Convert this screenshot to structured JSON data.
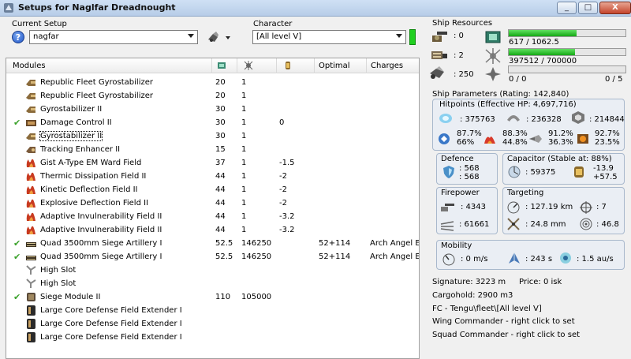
{
  "window": {
    "title": "Setups for Naglfar Dreadnought",
    "buttons": {
      "minimize": "_",
      "maximize": "□",
      "close": "X"
    }
  },
  "setup": {
    "current_setup_label": "Current Setup",
    "current_setup_value": "nagfar",
    "character_label": "Character",
    "character_value": "[All level V]"
  },
  "modules": {
    "headers": {
      "modules": "Modules",
      "optimal": "Optimal",
      "charges": "Charges"
    },
    "header_icons": [
      "cpu-icon",
      "powergrid-icon",
      "capacitor-icon"
    ],
    "rows": [
      {
        "checked": false,
        "icon": "gyrostabilizer-icon",
        "name": "Republic Fleet Gyrostabilizer",
        "cpu": "20",
        "pg": "1",
        "cap": "",
        "optimal": "",
        "charges": "",
        "selected": false
      },
      {
        "checked": false,
        "icon": "gyrostabilizer-icon",
        "name": "Republic Fleet Gyrostabilizer",
        "cpu": "20",
        "pg": "1",
        "cap": "",
        "optimal": "",
        "charges": "",
        "selected": false
      },
      {
        "checked": false,
        "icon": "gyrostabilizer-icon",
        "name": "Gyrostabilizer II",
        "cpu": "30",
        "pg": "1",
        "cap": "",
        "optimal": "",
        "charges": "",
        "selected": false
      },
      {
        "checked": true,
        "icon": "damage-control-icon",
        "name": "Damage Control II",
        "cpu": "30",
        "pg": "1",
        "cap": "0",
        "optimal": "",
        "charges": "",
        "selected": false
      },
      {
        "checked": false,
        "icon": "gyrostabilizer-icon",
        "name": "Gyrostabilizer II",
        "cpu": "30",
        "pg": "1",
        "cap": "",
        "optimal": "",
        "charges": "",
        "selected": true
      },
      {
        "checked": false,
        "icon": "tracking-enhancer-icon",
        "name": "Tracking Enhancer II",
        "cpu": "15",
        "pg": "1",
        "cap": "",
        "optimal": "",
        "charges": "",
        "selected": false
      },
      {
        "checked": false,
        "icon": "shield-hardener-icon",
        "name": "Gist A-Type EM Ward Field",
        "cpu": "37",
        "pg": "1",
        "cap": "-1.5",
        "optimal": "",
        "charges": "",
        "selected": false
      },
      {
        "checked": false,
        "icon": "shield-hardener-icon",
        "name": "Thermic Dissipation Field II",
        "cpu": "44",
        "pg": "1",
        "cap": "-2",
        "optimal": "",
        "charges": "",
        "selected": false
      },
      {
        "checked": false,
        "icon": "shield-hardener-icon",
        "name": "Kinetic Deflection Field II",
        "cpu": "44",
        "pg": "1",
        "cap": "-2",
        "optimal": "",
        "charges": "",
        "selected": false
      },
      {
        "checked": false,
        "icon": "shield-hardener-icon",
        "name": "Explosive Deflection Field II",
        "cpu": "44",
        "pg": "1",
        "cap": "-2",
        "optimal": "",
        "charges": "",
        "selected": false
      },
      {
        "checked": false,
        "icon": "shield-hardener-icon",
        "name": "Adaptive Invulnerability Field II",
        "cpu": "44",
        "pg": "1",
        "cap": "-3.2",
        "optimal": "",
        "charges": "",
        "selected": false
      },
      {
        "checked": false,
        "icon": "shield-hardener-icon",
        "name": "Adaptive Invulnerability Field II",
        "cpu": "44",
        "pg": "1",
        "cap": "-3.2",
        "optimal": "",
        "charges": "",
        "selected": false
      },
      {
        "checked": true,
        "icon": "artillery-icon",
        "name": "Quad 3500mm Siege Artillery I",
        "cpu": "52.5",
        "pg": "146250",
        "cap": "",
        "optimal": "52+114",
        "charges": "Arch Angel E",
        "selected": false
      },
      {
        "checked": true,
        "icon": "artillery-icon",
        "name": "Quad 3500mm Siege Artillery I",
        "cpu": "52.5",
        "pg": "146250",
        "cap": "",
        "optimal": "52+114",
        "charges": "Arch Angel E",
        "selected": false
      },
      {
        "checked": false,
        "icon": "high-slot-icon",
        "name": "High Slot",
        "cpu": "",
        "pg": "",
        "cap": "",
        "optimal": "",
        "charges": "",
        "selected": false
      },
      {
        "checked": false,
        "icon": "high-slot-icon",
        "name": "High Slot",
        "cpu": "",
        "pg": "",
        "cap": "",
        "optimal": "",
        "charges": "",
        "selected": false
      },
      {
        "checked": true,
        "icon": "siege-module-icon",
        "name": "Siege Module II",
        "cpu": "110",
        "pg": "105000",
        "cap": "",
        "optimal": "",
        "charges": "",
        "selected": false
      },
      {
        "checked": false,
        "icon": "rig-icon",
        "name": "Large Core Defense Field Extender I",
        "cpu": "",
        "pg": "",
        "cap": "",
        "optimal": "",
        "charges": "",
        "selected": false
      },
      {
        "checked": false,
        "icon": "rig-icon",
        "name": "Large Core Defense Field Extender I",
        "cpu": "",
        "pg": "",
        "cap": "",
        "optimal": "",
        "charges": "",
        "selected": false
      },
      {
        "checked": false,
        "icon": "rig-icon",
        "name": "Large Core Defense Field Extender I",
        "cpu": "",
        "pg": "",
        "cap": "",
        "optimal": "",
        "charges": "",
        "selected": false
      }
    ]
  },
  "resources": {
    "title": "Ship Resources",
    "turret": ": 0",
    "launcher": ": 2",
    "drone_bay": ": 250",
    "cpu": {
      "text": "617 / 1062.5",
      "fraction": 0.58
    },
    "powergrid": {
      "text": "397512 / 700000",
      "fraction": 0.568
    },
    "calibration_left": "0 / 0",
    "calibration_right": "0 / 5",
    "calibration_fraction": 0
  },
  "params": {
    "title": "Ship Parameters (Rating: 142,840)",
    "hitpoints": {
      "title": "Hitpoints (Effective HP: 4,697,716)",
      "shield": ": 375763",
      "armor": ": 236328",
      "structure": ": 214844",
      "shield_res": [
        "87.7%",
        "66%"
      ],
      "armor_res": [
        "88.3%",
        "44.8%"
      ],
      "structure_res": [
        "91.2%",
        "36.3%"
      ],
      "hull_res": [
        "92.7%",
        "23.5%"
      ]
    },
    "defence": {
      "title": "Defence",
      "top": ": 568",
      "bottom": ": 568"
    },
    "capacitor": {
      "title": "Capacitor (Stable at: 88%)",
      "capacity": ": 59375",
      "top": "-13.9",
      "bottom": "+57.5"
    },
    "firepower": {
      "title": "Firepower",
      "volley": ": 4343",
      "dps": ": 61661"
    },
    "targeting": {
      "title": "Targeting",
      "range": ": 127.19 km",
      "targets": ": 7",
      "resolution": ": 24.8 mm",
      "scan": ": 46.8"
    },
    "mobility": {
      "title": "Mobility",
      "speed": ": 0 m/s",
      "align": ": 243 s",
      "warp": ": 1.5 au/s"
    }
  },
  "info": {
    "signature": "Signature: 3223 m",
    "price": "Price: 0 isk",
    "cargohold": "Cargohold: 2900 m3",
    "fleet": "FC - Tengu\\fleet\\[All level V]",
    "wing": "Wing Commander - right click to set",
    "squad": "Squad Commander - right click to set"
  },
  "colors": {
    "progress_green": "#14a814",
    "check_green": "#3aa12a"
  }
}
